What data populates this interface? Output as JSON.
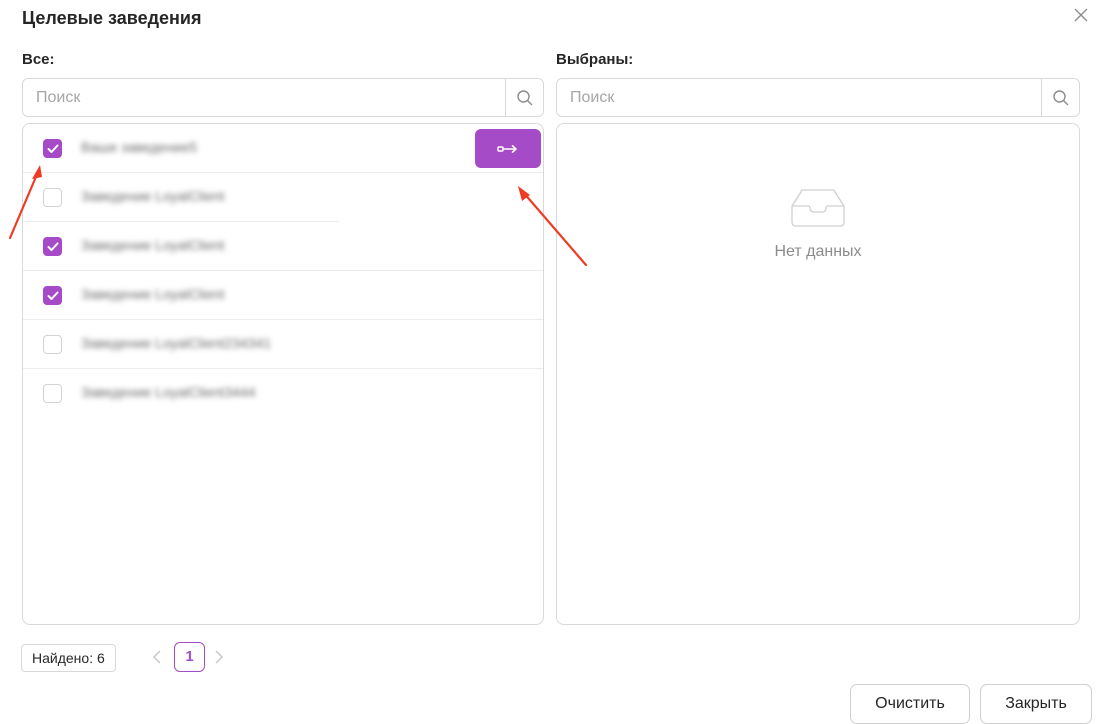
{
  "dialog": {
    "title": "Целевые заведения"
  },
  "left": {
    "label": "Все:",
    "search_placeholder": "Поиск",
    "items": [
      {
        "name": "Ваше заведение5",
        "checked": true
      },
      {
        "name": "Заведение LoyalClient",
        "checked": false
      },
      {
        "name": "Заведение LoyalClient",
        "checked": true
      },
      {
        "name": "Заведение LoyalClient",
        "checked": true
      },
      {
        "name": "Заведение LoyalClient234341",
        "checked": false
      },
      {
        "name": "Заведение LoyalClient3444",
        "checked": false
      }
    ]
  },
  "right": {
    "label": "Выбраны:",
    "search_placeholder": "Поиск",
    "empty_text": "Нет данных"
  },
  "footer": {
    "found": "Найдено: 6",
    "page": "1",
    "clear_label": "Очистить",
    "close_label": "Закрыть"
  },
  "icons": {
    "close": "close-icon",
    "search": "search-icon",
    "move": "move-right-icon",
    "empty": "empty-inbox-icon",
    "prev": "chevron-left-icon",
    "next": "chevron-right-icon",
    "check": "checkmark-icon"
  },
  "colors": {
    "accent": "#a64bc7",
    "annotation_arrow": "#ee3b24"
  }
}
